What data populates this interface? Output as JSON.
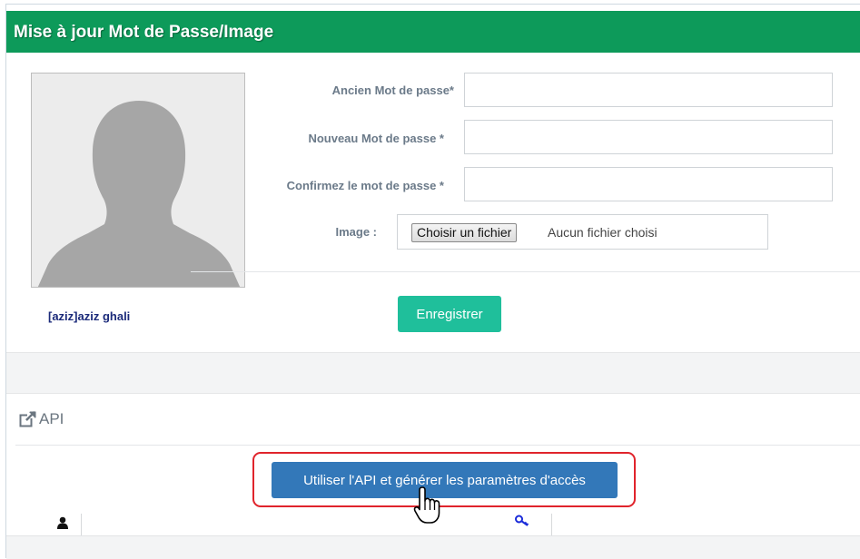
{
  "header": {
    "title": "Mise à jour Mot de Passe/Image"
  },
  "profile": {
    "user_name": "[aziz]aziz ghali"
  },
  "form": {
    "old_password_label": "Ancien Mot de passe*",
    "new_password_label": "Nouveau Mot de passe *",
    "confirm_password_label": "Confirmez le mot de passe *",
    "image_label": "Image :",
    "file_button_label": "Choisir un fichier",
    "file_status": "Aucun fichier choisi",
    "save_label": "Enregistrer"
  },
  "api": {
    "section_title": "API",
    "generate_label": "Utiliser l'API et générer les paramètres d'accès"
  },
  "table": {
    "col1_icon": "user-icon",
    "col2_icon": "key-icon"
  },
  "colors": {
    "header_bg": "#0d9a5a",
    "save_btn": "#1fbf9b",
    "api_btn": "#3378b9",
    "highlight": "#e0242c",
    "user_name": "#1b2a7a"
  }
}
